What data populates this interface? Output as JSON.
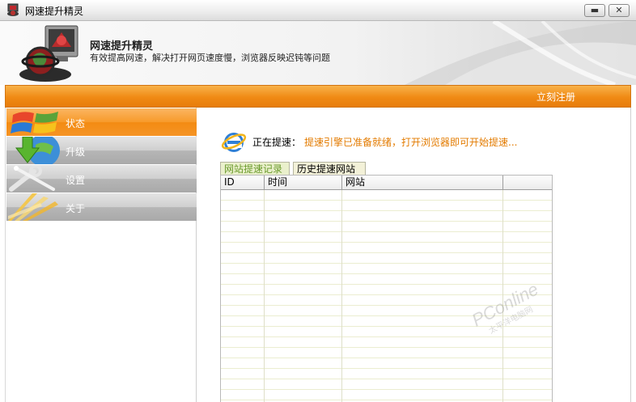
{
  "window": {
    "title": "网速提升精灵",
    "minimize_glyph": "▬",
    "close_glyph": "✕"
  },
  "header": {
    "title": "网速提升精灵",
    "subtitle": "有效提高网速，解决打开网页速度慢，浏览器反映迟钝等问题"
  },
  "toolbar": {
    "register_label": "立刻注册"
  },
  "sidebar": {
    "items": [
      {
        "label": "状态",
        "icon": "windows-logo-icon",
        "active": true
      },
      {
        "label": "升级",
        "icon": "download-arrow-icon",
        "active": false
      },
      {
        "label": "设置",
        "icon": "wrench-icon",
        "active": false
      },
      {
        "label": "关于",
        "icon": "light-rays-icon",
        "active": false
      }
    ]
  },
  "status": {
    "label": "正在提速：",
    "message": "提速引擎已准备就绪，打开浏览器即可开始提速..."
  },
  "tabs": [
    {
      "label": "网站提速记录",
      "active": false
    },
    {
      "label": "历史提速网站",
      "active": true
    }
  ],
  "table": {
    "columns": [
      "ID",
      "时间",
      "网站"
    ],
    "rows": []
  },
  "watermark": {
    "text": "PConline",
    "subtext": "太平洋电脑网"
  },
  "colors": {
    "accent_orange": "#f08a14",
    "status_message": "#e37b00",
    "tab_inactive_text": "#6a9a2c"
  }
}
